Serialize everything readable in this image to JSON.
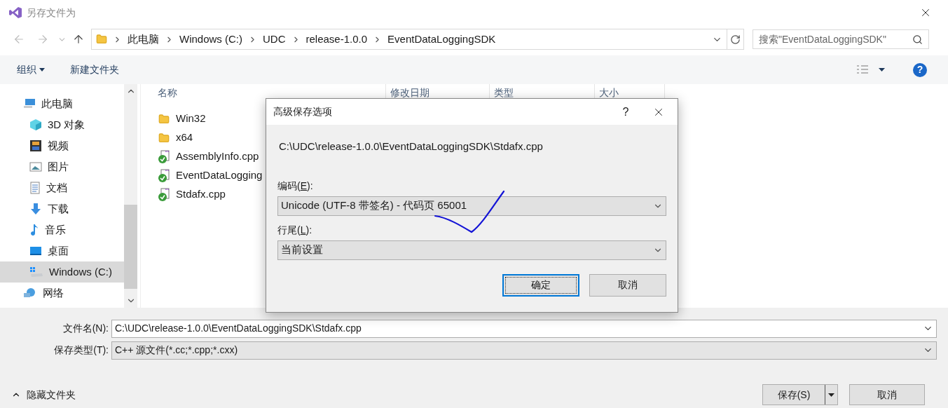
{
  "window": {
    "title": "另存文件为"
  },
  "address_bar": {
    "crumbs": [
      "此电脑",
      "Windows (C:)",
      "UDC",
      "release-1.0.0",
      "EventDataLoggingSDK"
    ]
  },
  "search": {
    "placeholder": "搜索\"EventDataLoggingSDK\""
  },
  "toolbar": {
    "organize": "组织",
    "new_folder": "新建文件夹",
    "help": "?"
  },
  "sidebar": {
    "items": [
      {
        "label": "此电脑",
        "kind": "pc",
        "selected": false,
        "children": [
          {
            "label": "3D 对象",
            "kind": "cube",
            "selected": false
          },
          {
            "label": "视频",
            "kind": "film",
            "selected": false
          },
          {
            "label": "图片",
            "kind": "image",
            "selected": false
          },
          {
            "label": "文档",
            "kind": "doc",
            "selected": false
          },
          {
            "label": "下载",
            "kind": "download",
            "selected": false
          },
          {
            "label": "音乐",
            "kind": "music",
            "selected": false
          },
          {
            "label": "桌面",
            "kind": "desktop",
            "selected": false
          },
          {
            "label": "Windows (C:)",
            "kind": "drive",
            "selected": true
          }
        ]
      },
      {
        "label": "网络",
        "kind": "network",
        "selected": false
      }
    ]
  },
  "table": {
    "columns": [
      "名称",
      "修改日期",
      "类型",
      "大小"
    ],
    "rows": [
      {
        "name": "Win32",
        "kind": "folder"
      },
      {
        "name": "x64",
        "kind": "folder"
      },
      {
        "name": "AssemblyInfo.cpp",
        "kind": "cpp"
      },
      {
        "name": "EventDataLogging",
        "kind": "cpp"
      },
      {
        "name": "Stdafx.cpp",
        "kind": "cpp"
      }
    ]
  },
  "dialog": {
    "title": "高级保存选项",
    "help": "?",
    "path": "C:\\UDC\\release-1.0.0\\EventDataLoggingSDK\\Stdafx.cpp",
    "fields": [
      {
        "label": "编码(**E**):",
        "value": "Unicode (UTF-8 带签名) - 代码页 65001"
      },
      {
        "label": "行尾(**L**):",
        "value": "当前设置"
      }
    ],
    "buttons": [
      {
        "label": "确定",
        "default": true
      },
      {
        "label": "取消",
        "default": false
      }
    ]
  },
  "file_name": {
    "label": "文件名(N):",
    "value": "C:\\UDC\\release-1.0.0\\EventDataLoggingSDK\\Stdafx.cpp"
  },
  "file_type": {
    "label": "保存类型(T):",
    "value": "C++ 源文件(*.cc;*.cpp;*.cxx)"
  },
  "hide_folders": "隐藏文件夹",
  "buttons": [
    {
      "label": "保存(S)",
      "split": true
    },
    {
      "label": "取消",
      "split": false
    }
  ]
}
